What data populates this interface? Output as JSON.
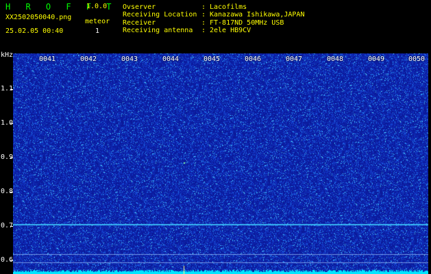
{
  "header": {
    "app_title": "H R O F F T",
    "app_version": "1.0.0",
    "filename": "XX2502050040.png",
    "datetime": "25.02.05 00:40",
    "mode_label": "meteor",
    "meteor_count": "1"
  },
  "info": {
    "rows": [
      {
        "label": "Ovserver",
        "value": "Lacofilms"
      },
      {
        "label": "Receiving Location",
        "value": "Kanazawa Ishikawa,JAPAN"
      },
      {
        "label": "Receiver",
        "value": "FT-817ND 50MHz USB"
      },
      {
        "label": "Receiving antenna",
        "value": "2ele HB9CV"
      }
    ],
    "separator": ":"
  },
  "spectrogram": {
    "y_unit": "kHz",
    "y_ticks": [
      "1.1",
      "1.0",
      "0.9",
      "0.8",
      "0.7",
      "0.6"
    ],
    "x_ticks": [
      "0041",
      "0042",
      "0043",
      "0044",
      "0045",
      "0046",
      "0047",
      "0048",
      "0049",
      "0050"
    ],
    "colors": {
      "background": "#0b1a9a",
      "noise_bright": "#3aa0ff",
      "noise_cyan": "#40e0ff",
      "signal_line": "#40d0ff",
      "floor": "#00e5ff"
    },
    "signal_khz": [
      0.706,
      0.618,
      0.595
    ]
  }
}
